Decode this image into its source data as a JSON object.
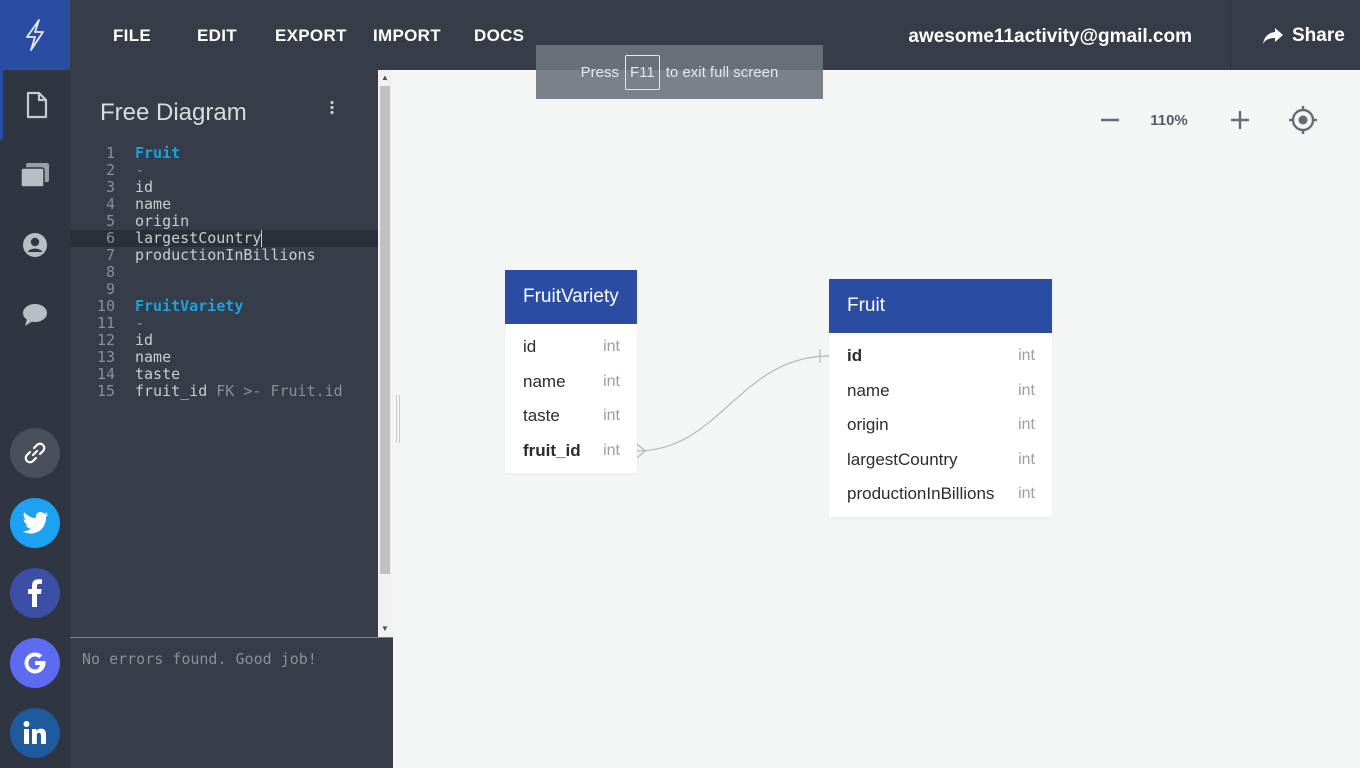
{
  "menu": {
    "file": "FILE",
    "edit": "EDIT",
    "export": "EXPORT",
    "import": "IMPORT",
    "docs": "DOCS"
  },
  "account": {
    "email": "awesome11activity@gmail.com"
  },
  "share": {
    "label": "Share"
  },
  "sidebar": {
    "items": [
      {
        "name": "document-icon"
      },
      {
        "name": "folders-icon"
      },
      {
        "name": "account-icon"
      },
      {
        "name": "chat-icon"
      }
    ],
    "social": [
      {
        "name": "link-icon",
        "color": "#4a505b"
      },
      {
        "name": "twitter-icon",
        "color": "#1da1f2"
      },
      {
        "name": "facebook-icon",
        "color": "#3b4fa5"
      },
      {
        "name": "google-icon",
        "color": "#5c6bf2"
      },
      {
        "name": "linkedin-icon",
        "color": "#1f5a9e"
      }
    ]
  },
  "editor": {
    "title": "Free Diagram",
    "lines": [
      {
        "n": "1",
        "text": "Fruit"
      },
      {
        "n": "2",
        "text": "-"
      },
      {
        "n": "3",
        "text": "id"
      },
      {
        "n": "4",
        "text": "name"
      },
      {
        "n": "5",
        "text": "origin"
      },
      {
        "n": "6",
        "text": "largestCountry"
      },
      {
        "n": "7",
        "text": "productionInBillions"
      },
      {
        "n": "8",
        "text": ""
      },
      {
        "n": "9",
        "text": ""
      },
      {
        "n": "10",
        "text": "FruitVariety"
      },
      {
        "n": "11",
        "text": "-"
      },
      {
        "n": "12",
        "text": "id"
      },
      {
        "n": "13",
        "text": "name"
      },
      {
        "n": "14",
        "text": "taste"
      },
      {
        "n": "15",
        "text": "fruit_id",
        "annotation": "FK >- Fruit.id"
      }
    ],
    "status": "No errors found. Good job!"
  },
  "toast": {
    "before": "Press",
    "key": "F11",
    "after": "to exit full screen"
  },
  "zoom": {
    "level": "110%"
  },
  "diagram": {
    "tables": [
      {
        "name": "FruitVariety",
        "columns": [
          {
            "name": "id",
            "type": "int"
          },
          {
            "name": "name",
            "type": "int"
          },
          {
            "name": "taste",
            "type": "int"
          },
          {
            "name": "fruit_id",
            "type": "int"
          }
        ]
      },
      {
        "name": "Fruit",
        "columns": [
          {
            "name": "id",
            "type": "int"
          },
          {
            "name": "name",
            "type": "int"
          },
          {
            "name": "origin",
            "type": "int"
          },
          {
            "name": "largestCountry",
            "type": "int"
          },
          {
            "name": "productionInBillions",
            "type": "int"
          }
        ]
      }
    ]
  },
  "colors": {
    "brand": "#2a4ca3",
    "keyword": "#1aa3e0",
    "status_ok": "#1eb980"
  }
}
